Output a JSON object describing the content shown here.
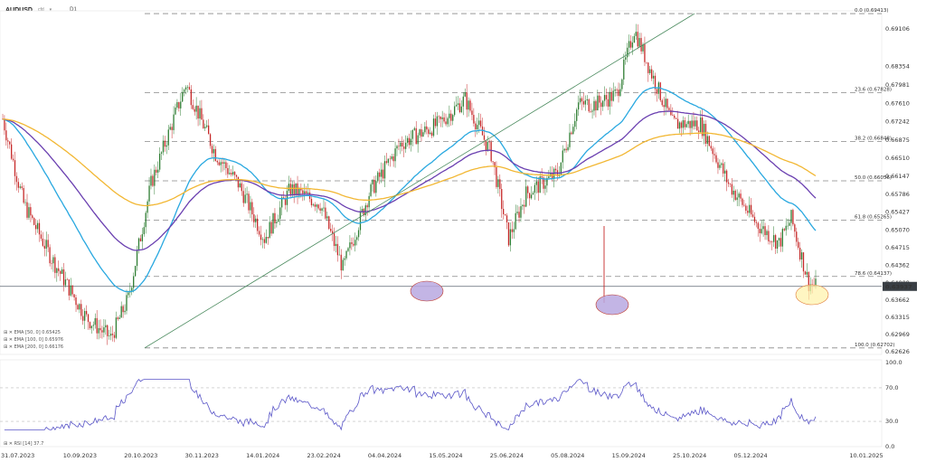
{
  "header": {
    "symbol": "AUDUSD",
    "symbol_suffix": "cfd",
    "timeframe": "D1"
  },
  "indicators": {
    "ema50": "EMA [50, 0] 0.65425",
    "ema100": "EMA [100, 0] 0.65976",
    "ema200": "EMA [200, 0] 0.66176",
    "rsi": "RSI [14] 37.7"
  },
  "colors": {
    "bull": "#2e7d32",
    "bear": "#c62828",
    "ema50": "#29a8e0",
    "ema100": "#6a3fb0",
    "ema200": "#f2b733",
    "rsi": "#5a56c8",
    "fib": "#888888",
    "trend": "#4a8a5e",
    "circle_purple": "#b9a8e0",
    "circle_yellow": "#fff2a8"
  },
  "chart_data": {
    "type": "candlestick",
    "price_axis": [
      "0.69106",
      "0.68354",
      "0.67981",
      "0.67610",
      "0.67242",
      "0.66875",
      "0.66510",
      "0.66147",
      "0.65786",
      "0.65427",
      "0.65070",
      "0.64715",
      "0.64362",
      "0.64009",
      "0.63662",
      "0.63315",
      "0.62969",
      "0.62626"
    ],
    "last_price": "0.63937",
    "date_axis": [
      "31.07.2023",
      "10.09.2023",
      "20.10.2023",
      "30.11.2023",
      "14.01.2024",
      "23.02.2024",
      "04.04.2024",
      "15.05.2024",
      "25.06.2024",
      "05.08.2024",
      "15.09.2024",
      "25.10.2024",
      "05.12.2024",
      "10.01.2025"
    ],
    "fib_levels": [
      {
        "label": "0.0 (0.69413)",
        "price": 0.69413
      },
      {
        "label": "23.6 (0.67828)",
        "price": 0.67828
      },
      {
        "label": "38.2 (0.66848)",
        "price": 0.66848
      },
      {
        "label": "50.0 (0.66056)",
        "price": 0.66056
      },
      {
        "label": "61.8 (0.65265)",
        "price": 0.65265
      },
      {
        "label": "78.6 (0.64137)",
        "price": 0.64137
      },
      {
        "label": "100.0 (0.62702)",
        "price": 0.62702
      }
    ],
    "rsi_axis": [
      "100.0",
      "70.0",
      "30.0",
      "0.0"
    ],
    "rsi_levels": [
      70,
      30
    ]
  }
}
